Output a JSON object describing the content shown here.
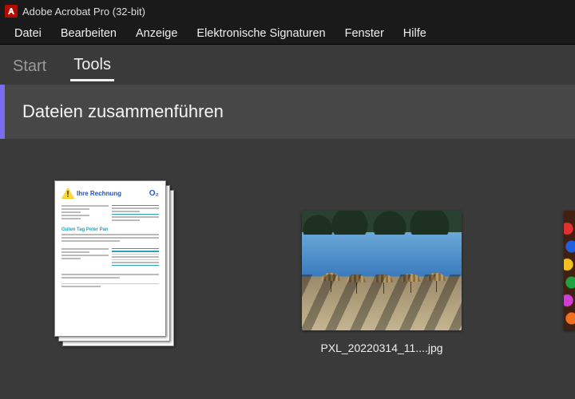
{
  "window": {
    "title": "Adobe Acrobat Pro (32-bit)"
  },
  "menu": {
    "datei": "Datei",
    "bearbeiten": "Bearbeiten",
    "anzeige": "Anzeige",
    "signaturen": "Elektronische Signaturen",
    "fenster": "Fenster",
    "hilfe": "Hilfe"
  },
  "tabs": {
    "start": "Start",
    "tools": "Tools"
  },
  "tool": {
    "title": "Dateien zusammenführen"
  },
  "files": {
    "pdf": {
      "header": "Ihre Rechnung",
      "brand": "O₂",
      "section": "Guten Tag Peter Pan"
    },
    "photo": {
      "caption": "PXL_20220314_11....jpg"
    }
  }
}
